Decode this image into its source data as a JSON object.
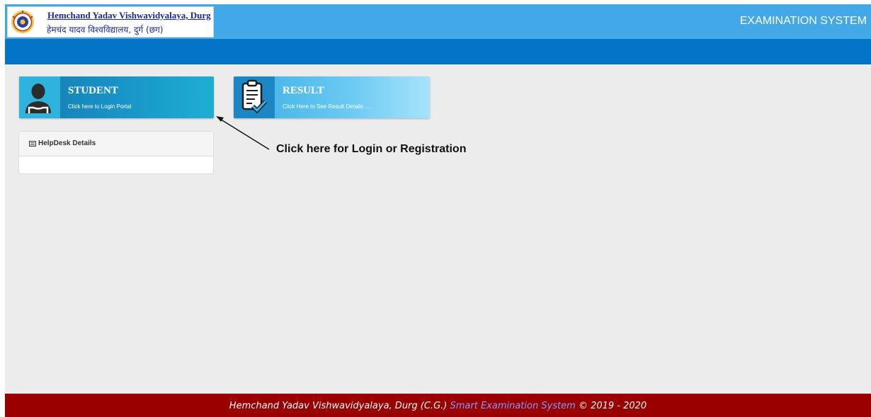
{
  "header": {
    "logo_title_en": "Hemchand Yadav Vishwavidyalaya, Durg",
    "logo_title_hi": "हेमचंद यादव विश्वविद्यालय, दुर्ग (छग)",
    "app_title": "EXAMINATION SYSTEM"
  },
  "tiles": [
    {
      "title": "STUDENT",
      "subtitle": "Click here to Login Portal",
      "icon": "user-icon"
    },
    {
      "title": "RESULT",
      "subtitle": "Click Here to See Result Details ....",
      "icon": "clipboard-check-icon"
    }
  ],
  "helpdesk": {
    "title": "HelpDesk Details",
    "icon": "list-icon"
  },
  "annotation": {
    "text": "Click here for Login or Registration"
  },
  "footer": {
    "prefix": "Hemchand Yadav Vishwavidyalaya, Durg (C.G.) ",
    "highlight": "Smart Examination System",
    "suffix": " © 2019 - 2020"
  },
  "colors": {
    "topbar": "#42a8e8",
    "navbar": "#0474c8",
    "background": "#ececec",
    "footer": "#990000",
    "footer_accent": "#7f9bff"
  }
}
